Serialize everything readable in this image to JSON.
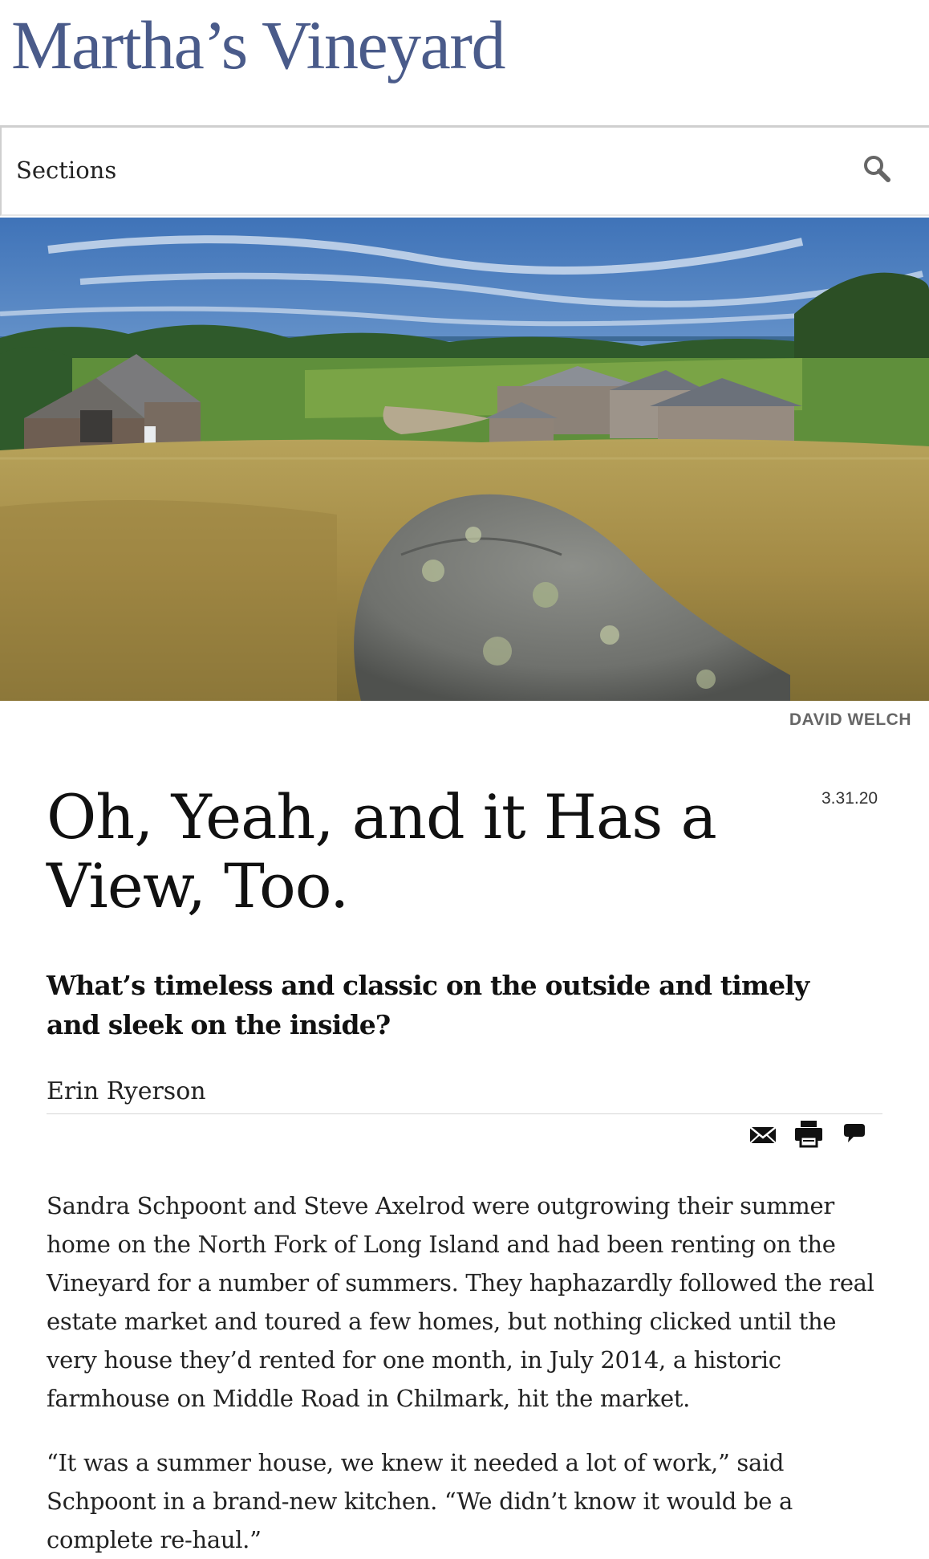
{
  "header": {
    "logo": "Martha’s Vineyard"
  },
  "nav": {
    "sections_label": "Sections",
    "search_icon": "magnifier-icon"
  },
  "hero": {
    "photo_credit": "DAVID WELCH"
  },
  "article": {
    "date": "3.31.20",
    "headline": "Oh, Yeah, and it Has a View, Too.",
    "dek": "What’s timeless and classic on the outside and timely and sleek on the inside?",
    "author": "Erin Ryerson",
    "share_icons": [
      "email-icon",
      "print-icon",
      "comment-icon"
    ],
    "paragraphs": [
      "Sandra Schpoont and Steve Axelrod were outgrowing their summer home on the North Fork of Long Island and had been renting on the Vineyard for a number of summers. They haphazardly followed the real estate market and toured a few homes, but nothing clicked until the very house they’d rented for one month, in July 2014, a historic farmhouse on Middle Road in Chilmark, hit the market.",
      "“It was a summer house, we knew it needed a lot of work,” said Schpoont in a brand-new kitchen. “We didn’t know it would be a complete re-haul.”"
    ]
  },
  "colors": {
    "logo": "#4a5b8a",
    "credit": "#666666",
    "text": "#222222"
  }
}
